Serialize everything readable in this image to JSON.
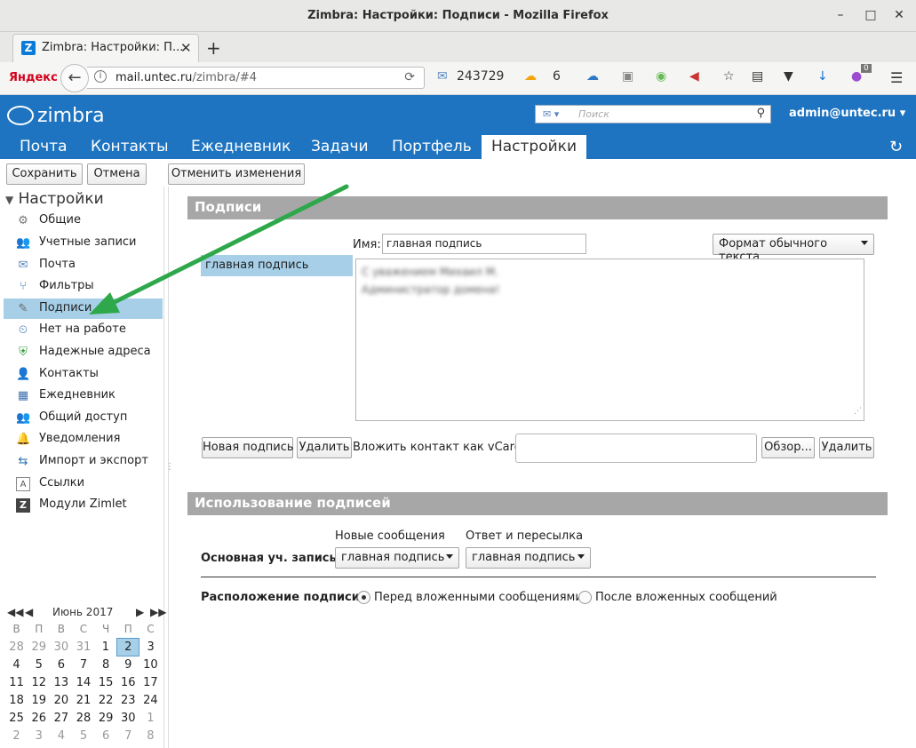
{
  "window": {
    "title": "Zimbra: Настройки: Подписи - Mozilla Firefox"
  },
  "browser": {
    "tab_label": "Zimbra: Настройки: П...",
    "yandex": "Яндекс",
    "url_domain": "mail.untec.ru",
    "url_path": "/zimbra/#4",
    "mail_count": "243729",
    "weather_temp": "6",
    "badge_count": "0"
  },
  "zimbra": {
    "logo": "zimbra",
    "search_placeholder": "Поиск",
    "user": "admin@untec.ru",
    "tabs": [
      "Почта",
      "Контакты",
      "Ежедневник",
      "Задачи",
      "Портфель",
      "Настройки"
    ]
  },
  "toolbar": {
    "save": "Сохранить",
    "cancel": "Отмена",
    "revert": "Отменить изменения"
  },
  "sidebar": {
    "title": "Настройки",
    "items": [
      {
        "label": "Общие",
        "icon": "gears-icon"
      },
      {
        "label": "Учетные записи",
        "icon": "accounts-icon"
      },
      {
        "label": "Почта",
        "icon": "mail-icon"
      },
      {
        "label": "Фильтры",
        "icon": "filter-icon"
      },
      {
        "label": "Подписи",
        "icon": "signature-icon"
      },
      {
        "label": "Нет на работе",
        "icon": "out-of-office-icon"
      },
      {
        "label": "Надежные адреса",
        "icon": "shield-icon"
      },
      {
        "label": "Контакты",
        "icon": "contact-icon"
      },
      {
        "label": "Ежедневник",
        "icon": "calendar-icon"
      },
      {
        "label": "Общий доступ",
        "icon": "sharing-icon"
      },
      {
        "label": "Уведомления",
        "icon": "bell-icon"
      },
      {
        "label": "Импорт и экспорт",
        "icon": "import-export-icon"
      },
      {
        "label": "Ссылки",
        "icon": "shortcuts-icon"
      },
      {
        "label": "Модули Zimlet",
        "icon": "zimlet-icon"
      }
    ]
  },
  "calendar": {
    "month": "Июнь 2017",
    "weekdays": [
      "В",
      "П",
      "В",
      "С",
      "Ч",
      "П",
      "С"
    ],
    "weeks": [
      [
        "28",
        "29",
        "30",
        "31",
        "1",
        "2",
        "3"
      ],
      [
        "4",
        "5",
        "6",
        "7",
        "8",
        "9",
        "10"
      ],
      [
        "11",
        "12",
        "13",
        "14",
        "15",
        "16",
        "17"
      ],
      [
        "18",
        "19",
        "20",
        "21",
        "22",
        "23",
        "24"
      ],
      [
        "25",
        "26",
        "27",
        "28",
        "29",
        "30",
        "1"
      ],
      [
        "2",
        "3",
        "4",
        "5",
        "6",
        "7",
        "8"
      ]
    ],
    "today": "2"
  },
  "signatures": {
    "section_title": "Подписи",
    "name_label": "Имя:",
    "name_value": "главная подпись",
    "format": "Формат обычного текста",
    "list": [
      "главная подпись"
    ],
    "body_line1": "С уважением Михаил М.",
    "body_line2": "Администратор домена!",
    "new_button": "Новая подпись",
    "delete_button": "Удалить",
    "vcard_label": "Вложить контакт как vCard:",
    "browse_button": "Обзор...",
    "vcard_delete": "Удалить"
  },
  "usage": {
    "section_title": "Использование подписей",
    "col_new": "Новые сообщения",
    "col_reply": "Ответ и пересылка",
    "account_label": "Основная уч. запись:",
    "new_value": "главная подпись",
    "reply_value": "главная подпись",
    "placement_label": "Расположение подписи:",
    "option_before": "Перед вложенными сообщениями",
    "option_after": "После вложенных сообщений",
    "selected": "before"
  },
  "colors": {
    "header": "#1e74c0",
    "selection": "#a7d0e8",
    "section": "#a7a7a7",
    "arrow": "#2ea84b"
  }
}
